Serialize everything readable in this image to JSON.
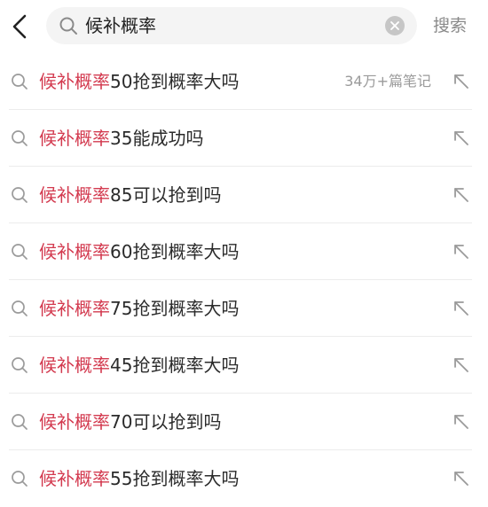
{
  "search": {
    "query": "候补概率",
    "action_label": "搜索"
  },
  "suggestions": [
    {
      "highlight": "候补概率",
      "rest": "50抢到概率大吗",
      "meta": "34万+篇笔记"
    },
    {
      "highlight": "候补概率",
      "rest": "35能成功吗",
      "meta": ""
    },
    {
      "highlight": "候补概率",
      "rest": "85可以抢到吗",
      "meta": ""
    },
    {
      "highlight": "候补概率",
      "rest": "60抢到概率大吗",
      "meta": ""
    },
    {
      "highlight": "候补概率",
      "rest": "75抢到概率大吗",
      "meta": ""
    },
    {
      "highlight": "候补概率",
      "rest": "45抢到概率大吗",
      "meta": ""
    },
    {
      "highlight": "候补概率",
      "rest": "70可以抢到吗",
      "meta": ""
    },
    {
      "highlight": "候补概率",
      "rest": "55抢到概率大吗",
      "meta": ""
    }
  ],
  "colors": {
    "highlight": "#d33a4f",
    "text": "#2b2b2b",
    "muted": "#9a9a9a"
  },
  "icons": {
    "back": "chevron-left-icon",
    "search": "search-icon",
    "clear": "clear-icon",
    "fill": "arrow-up-left-icon"
  }
}
